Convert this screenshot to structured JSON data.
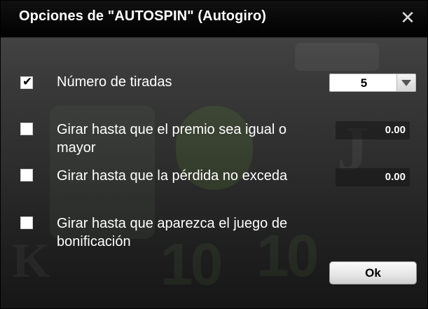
{
  "dialog": {
    "title": "Opciones de \"AUTOSPIN\" (Autogiro)",
    "close_icon": "close-icon"
  },
  "options": [
    {
      "id": "spins",
      "checked": true,
      "label": "Número de tiradas"
    },
    {
      "id": "win",
      "checked": false,
      "label_line1": "Girar hasta que el premio sea igual o",
      "label_line2": "mayor",
      "value": "0.00"
    },
    {
      "id": "loss",
      "checked": false,
      "label": "Girar hasta que la pérdida no exceda",
      "value": "0.00"
    },
    {
      "id": "bonus",
      "checked": false,
      "label_line1": "Girar hasta que aparezca el juego de",
      "label_line2": "bonificación"
    }
  ],
  "spins_select": {
    "value": "5",
    "arrow_icon": "chevron-down-icon"
  },
  "ok_label": "Ok"
}
